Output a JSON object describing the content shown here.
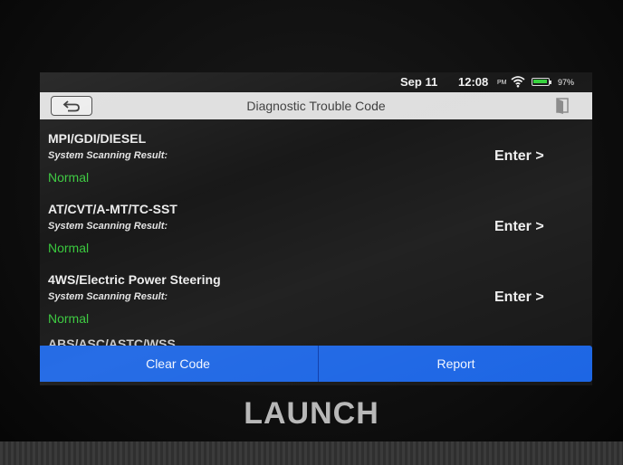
{
  "status_bar": {
    "date": "Sep 11",
    "time": "12:08",
    "ampm": "PM",
    "battery_percent": "97%",
    "battery_level": 0.97,
    "icons": [
      "wifi-icon",
      "battery-icon"
    ]
  },
  "header": {
    "title": "Diagnostic Trouble Code",
    "back_icon": "back-arrow-icon",
    "exit_icon": "exit-icon"
  },
  "systems": [
    {
      "name": "MPI/GDI/DIESEL",
      "label": "System Scanning Result:",
      "result": "Normal",
      "action": "Enter >"
    },
    {
      "name": "AT/CVT/A-MT/TC-SST",
      "label": "System Scanning Result:",
      "result": "Normal",
      "action": "Enter >"
    },
    {
      "name": "4WS/Electric Power Steering",
      "label": "System Scanning Result:",
      "result": "Normal",
      "action": "Enter >"
    },
    {
      "name": "ABS/ASC/ASTC/WSS"
    }
  ],
  "actions": {
    "clear_code": "Clear Code",
    "report": "Report"
  },
  "colors": {
    "result_normal": "#36c83a",
    "action_bar": "#1a64e4",
    "title_bar": "#dedede"
  },
  "device": {
    "logo": "LAUNCH"
  }
}
